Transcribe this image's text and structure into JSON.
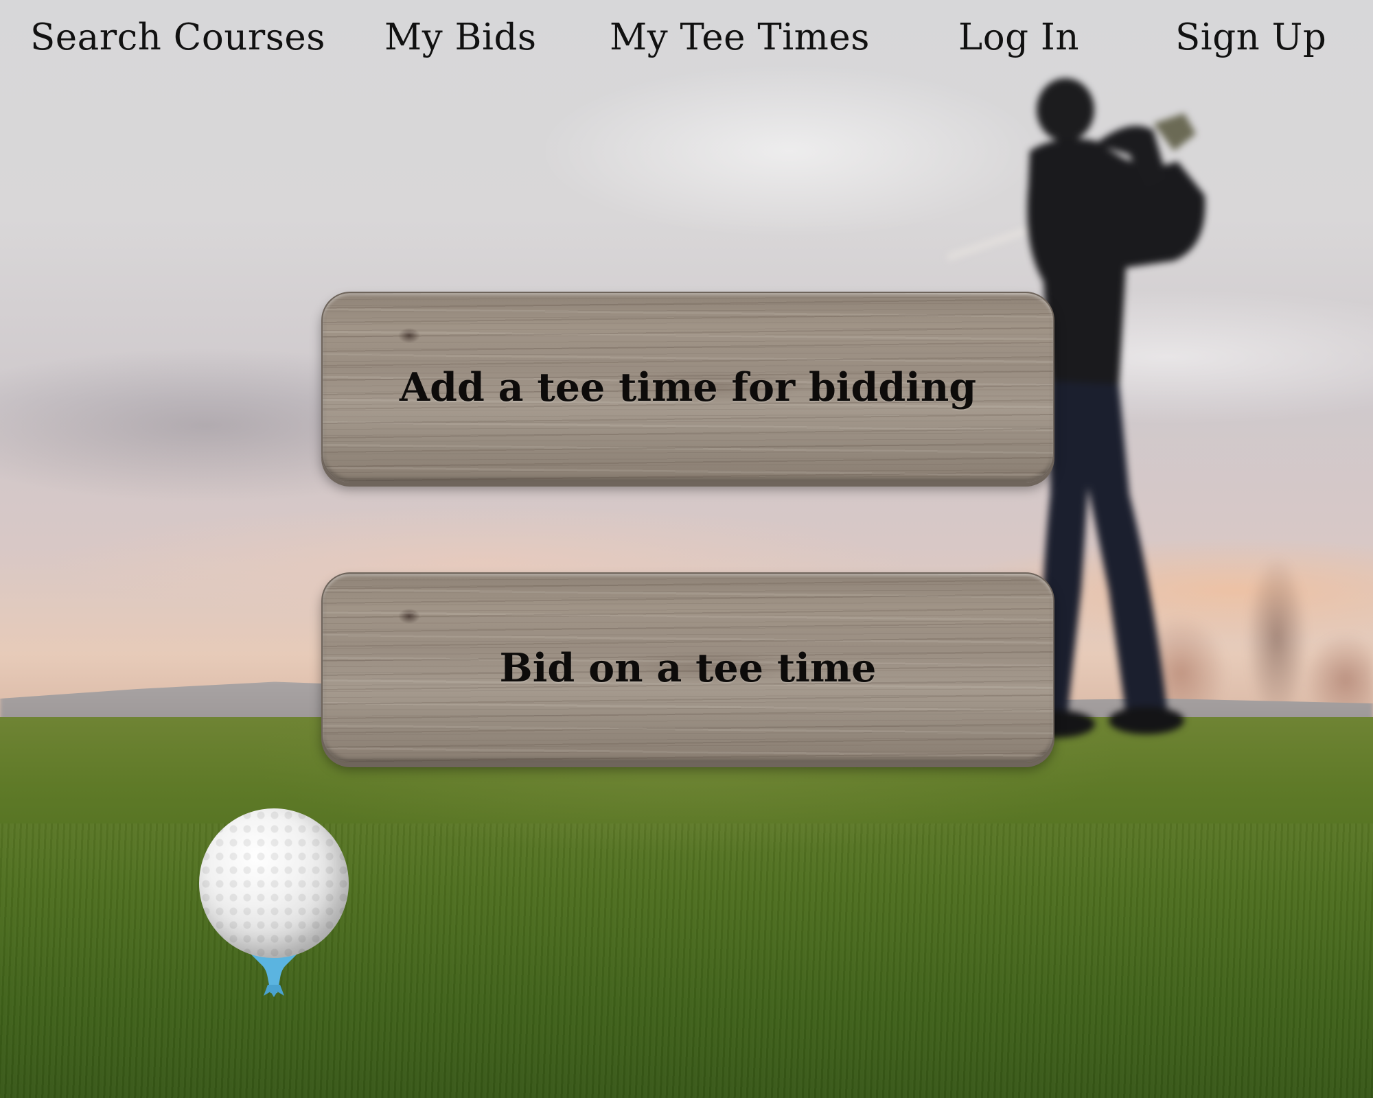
{
  "nav": {
    "items": [
      {
        "id": "search",
        "label": "Search Courses"
      },
      {
        "id": "bids",
        "label": "My Bids"
      },
      {
        "id": "tee_times",
        "label": "My Tee Times"
      },
      {
        "id": "login",
        "label": "Log In"
      },
      {
        "id": "signup",
        "label": "Sign Up"
      }
    ]
  },
  "actions": {
    "add_tee_time": "Add a tee time for bidding",
    "bid_tee_time": "Bid on a tee time"
  },
  "colors": {
    "nav_text": "#111111",
    "button_text": "#0d0b0a",
    "wood": "#9a8e82",
    "grass": "#4d6e1e",
    "sky": "#d7d7d9",
    "tee": "#5bb4e0"
  },
  "icons": {
    "golf_ball": "golf-ball-icon",
    "tee": "golf-tee-icon"
  }
}
